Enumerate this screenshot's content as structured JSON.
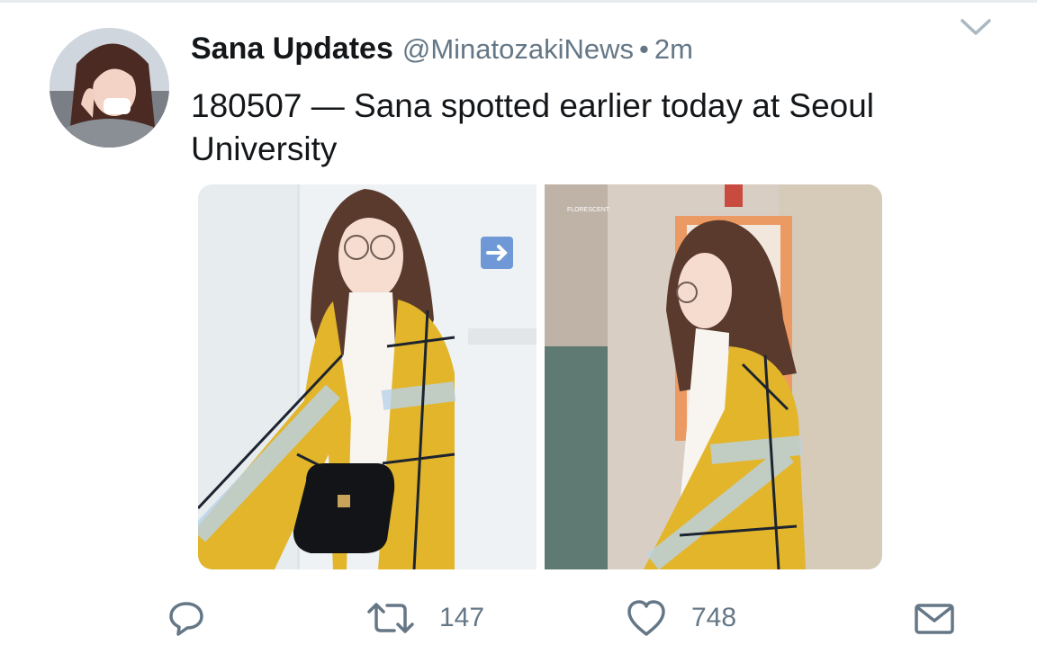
{
  "tweet": {
    "author_name": "Sana Updates",
    "handle": "@MinatozakiNews",
    "separator": "•",
    "time": "2m",
    "text": "180507 — Sana spotted earlier today at Seoul University"
  },
  "icons": {
    "menu": "chevron-down-icon",
    "reply": "reply-icon",
    "retweet": "retweet-icon",
    "like": "heart-icon",
    "message": "envelope-icon"
  },
  "actions": {
    "retweet_count": "147",
    "like_count": "748"
  },
  "colors": {
    "text_primary": "#14171a",
    "text_secondary": "#657786",
    "icon": "#657786",
    "cardigan_yellow": "#e2b52a"
  }
}
